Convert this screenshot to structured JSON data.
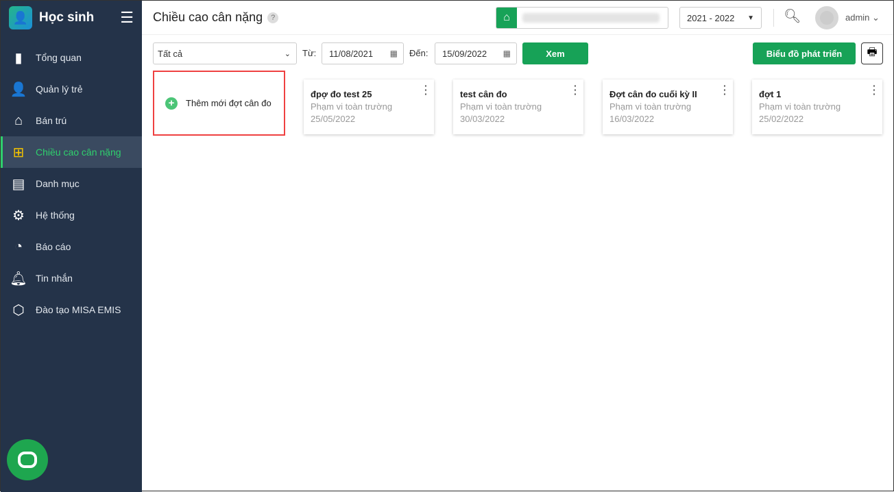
{
  "app": {
    "name": "Học sinh"
  },
  "sidebar": {
    "items": [
      {
        "label": "Tổng quan",
        "icon": "bar-chart-icon"
      },
      {
        "label": "Quản lý trẻ",
        "icon": "person-icon"
      },
      {
        "label": "Bán trú",
        "icon": "house-icon"
      },
      {
        "label": "Chiều cao cân nặng",
        "icon": "medkit-icon"
      },
      {
        "label": "Danh mục",
        "icon": "folder-icon"
      },
      {
        "label": "Hệ thống",
        "icon": "gear-icon"
      },
      {
        "label": "Báo cáo",
        "icon": "pie-chart-icon"
      },
      {
        "label": "Tin nhắn",
        "icon": "bell-icon"
      },
      {
        "label": "Đào tạo MISA EMIS",
        "icon": "cube-icon"
      }
    ]
  },
  "header": {
    "title": "Chiều cao cân nặng",
    "help": "?",
    "year": "2021 - 2022",
    "user": "admin"
  },
  "toolbar": {
    "filter": "Tất cả",
    "from_label": "Từ:",
    "from": "11/08/2021",
    "to_label": "Đến:",
    "to": "15/09/2022",
    "view": "Xem",
    "chart": "Biểu đồ phát triển"
  },
  "add_label": "Thêm mới đợt cân đo",
  "cards": [
    {
      "name": "đpợ đo test 25",
      "scope": "Phạm vi toàn trường",
      "date": "25/05/2022"
    },
    {
      "name": "test cân đo",
      "scope": "Phạm vi toàn trường",
      "date": "30/03/2022"
    },
    {
      "name": "Đợt cân đo cuối kỳ II",
      "scope": "Phạm vi toàn trường",
      "date": "16/03/2022"
    },
    {
      "name": "đợt 1",
      "scope": "Phạm vi toàn trường",
      "date": "25/02/2022"
    }
  ]
}
